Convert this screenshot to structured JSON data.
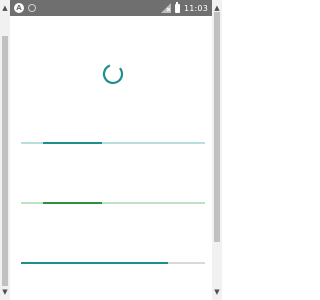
{
  "status_bar": {
    "time": "11:03",
    "badge_a": "A",
    "icons": [
      "notification-a-icon",
      "notification-circle-icon",
      "no-signal-icon",
      "battery-icon"
    ]
  },
  "colors": {
    "status_bar_bg": "#6f6f6f",
    "teal_accent": "#1f8e8c",
    "teal_track": "#b8dedd",
    "green_accent": "#2e8f3e",
    "green_track": "#bfe1c4",
    "gray_track": "#d9d9d9"
  },
  "spinner": {
    "icon": "loading-spinner-icon"
  },
  "progress_bars": [
    {
      "style": "indeterminate",
      "segment_start": 0.12,
      "segment_end": 0.44,
      "color": "#1f8e8c",
      "track": "#b8dedd"
    },
    {
      "style": "indeterminate",
      "segment_start": 0.12,
      "segment_end": 0.44,
      "color": "#2e8f3e",
      "track": "#bfe1c4"
    },
    {
      "style": "determinate",
      "progress": 0.8,
      "color": "#1f8e8c",
      "track": "#d9d9d9"
    }
  ]
}
